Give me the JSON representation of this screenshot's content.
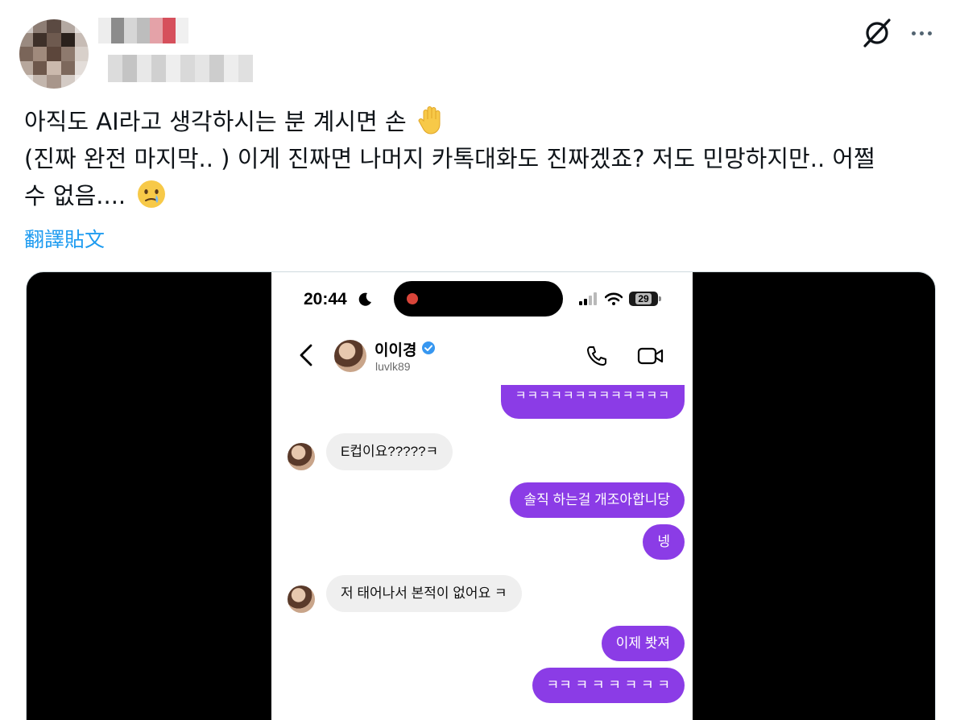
{
  "header": {
    "more_icon": "more-dots-icon",
    "grok_icon": "grok-icon"
  },
  "tweet": {
    "line1": "아직도 AI라고 생각하시는 분 계시면 손",
    "line2": "(진짜 완전 마지막.. ) 이게 진짜면 나머지 카톡대화도 진짜겠죠? 저도 민망하지만.. 어쩔",
    "line3": "수 없음....",
    "emoji1": "raised-hand-emoji",
    "emoji2": "face-holding-back-tears-emoji",
    "translate_label": "翻譯貼文"
  },
  "phone": {
    "status_time": "20:44",
    "battery": "29",
    "contact_name": "이이경",
    "contact_handle": "luvlk89",
    "messages": [
      {
        "side": "out",
        "text": "ㅋㅋㅋㅋㅋㅋㅋㅋㅋㅋㅋㅋㅋ"
      },
      {
        "side": "in",
        "text": "E컵이요?????ㅋ"
      },
      {
        "side": "out",
        "text": "솔직 하는걸 개조아합니당"
      },
      {
        "side": "out",
        "text": "넹"
      },
      {
        "side": "in",
        "text": "저 태어나서 본적이 없어요 ㅋ"
      },
      {
        "side": "out",
        "text": "이제 봣져"
      },
      {
        "side": "out",
        "text": "ㅋㅋ ㅋ ㅋ ㅋ ㅋ ㅋ ㅋ"
      }
    ]
  },
  "colors": {
    "link": "#1d9bf0",
    "bubble_out": "#8b3ce6",
    "bubble_in": "#efefef"
  }
}
